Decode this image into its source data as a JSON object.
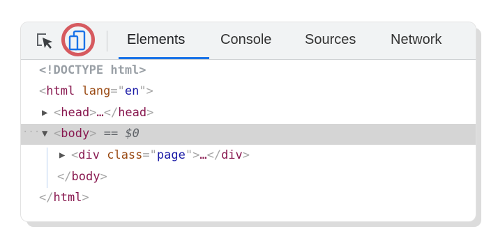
{
  "toolbar": {
    "icons": [
      "inspect-element-icon",
      "device-toolbar-icon"
    ],
    "highlight_color": "#d65a5f",
    "active_tab_color": "#1a73e8",
    "tabs": [
      {
        "label": "Elements",
        "active": true
      },
      {
        "label": "Console",
        "active": false
      },
      {
        "label": "Sources",
        "active": false
      },
      {
        "label": "Network",
        "active": false
      }
    ]
  },
  "dom": {
    "doctype": "<!DOCTYPE html>",
    "html_open": {
      "tag": "html",
      "attr_name": "lang",
      "attr_value": "en"
    },
    "head": {
      "open": "head",
      "ellipsis": "…",
      "close": "head"
    },
    "body": {
      "tag": "body",
      "eq": "==",
      "ref": "$0"
    },
    "div": {
      "tag": "div",
      "attr_name": "class",
      "attr_value": "page",
      "ellipsis": "…",
      "close": "div"
    },
    "body_close": "body",
    "html_close": "html",
    "more_dots": "···",
    "collapsed_triangle": "▶",
    "expanded_triangle": "▼"
  }
}
